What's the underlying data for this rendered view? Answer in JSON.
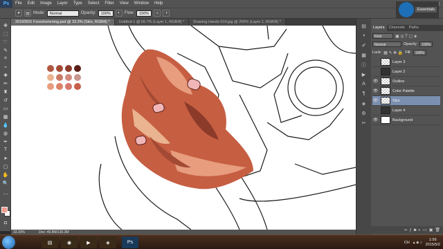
{
  "app": {
    "logo": "Ps"
  },
  "menu": [
    "File",
    "Edit",
    "Image",
    "Layer",
    "Type",
    "Select",
    "Filter",
    "View",
    "Window",
    "Help"
  ],
  "window_controls": {
    "minimize": "—",
    "maximize": "□",
    "close": "✕"
  },
  "options": {
    "mode_label": "Mode:",
    "mode_value": "Normal",
    "opacity_label": "Opacity:",
    "opacity_value": "100%",
    "flow_label": "Flow:",
    "flow_value": "100%"
  },
  "workspace": {
    "label": "Essentials"
  },
  "tabs": [
    {
      "label": "20150501 Foreshortening.psd @ 33.3% (Skin, RGB/8) *",
      "active": true
    },
    {
      "label": "Untitled-1 @ 66.7% (Layer 1, RGB/8) *",
      "active": false
    },
    {
      "label": "Drawing Hands 014.jpg @ 200% (Layer 1, RGB/8) *",
      "active": false
    }
  ],
  "status": {
    "zoom": "33.33%",
    "doc": "Doc: 49.8M/130.3M"
  },
  "layers_panel": {
    "tabs": [
      "Layers",
      "Channels",
      "Paths"
    ],
    "filter_kind": "Kind",
    "blend_mode": "Normal",
    "opacity_label": "Opacity:",
    "opacity_value": "100%",
    "lock_label": "Lock:",
    "fill_label": "Fill:",
    "fill_value": "100%",
    "layers": [
      {
        "name": "Layer 3",
        "visible": false,
        "selected": false,
        "thumb": "transparent"
      },
      {
        "name": "Layer 2",
        "visible": false,
        "selected": false,
        "thumb": "dark"
      },
      {
        "name": "Outline",
        "visible": true,
        "selected": false,
        "thumb": "transparent"
      },
      {
        "name": "Color Palette",
        "visible": true,
        "selected": false,
        "thumb": "transparent"
      },
      {
        "name": "Skin",
        "visible": true,
        "selected": true,
        "thumb": "transparent"
      },
      {
        "name": "Layer 4",
        "visible": false,
        "selected": false,
        "thumb": "dark"
      },
      {
        "name": "Background",
        "visible": true,
        "selected": false,
        "thumb": "white"
      }
    ],
    "footer_icons": [
      "link-icon",
      "fx-icon",
      "mask-icon",
      "adjustment-icon",
      "folder-icon",
      "new-layer-icon",
      "trash-icon"
    ]
  },
  "palette_colors": [
    "#b0573f",
    "#a34a35",
    "#8c3a2a",
    "#5a1f18",
    "#e9b48f",
    "#c97b63",
    "#d28a7f",
    "#c7978f",
    "#e79d7e",
    "#db8266",
    "#d5776a",
    "#c85f4a"
  ],
  "taskbar": {
    "apps": [
      "file-explorer-icon",
      "chrome-icon",
      "media-player-icon",
      "nvidia-icon",
      "photoshop-icon"
    ],
    "language": "CH",
    "time": "1:56",
    "date": "2015/5/2"
  },
  "colors": {
    "foreground": "#f29a8e",
    "background": "#ffffff",
    "accent": "#7b8fb0"
  }
}
